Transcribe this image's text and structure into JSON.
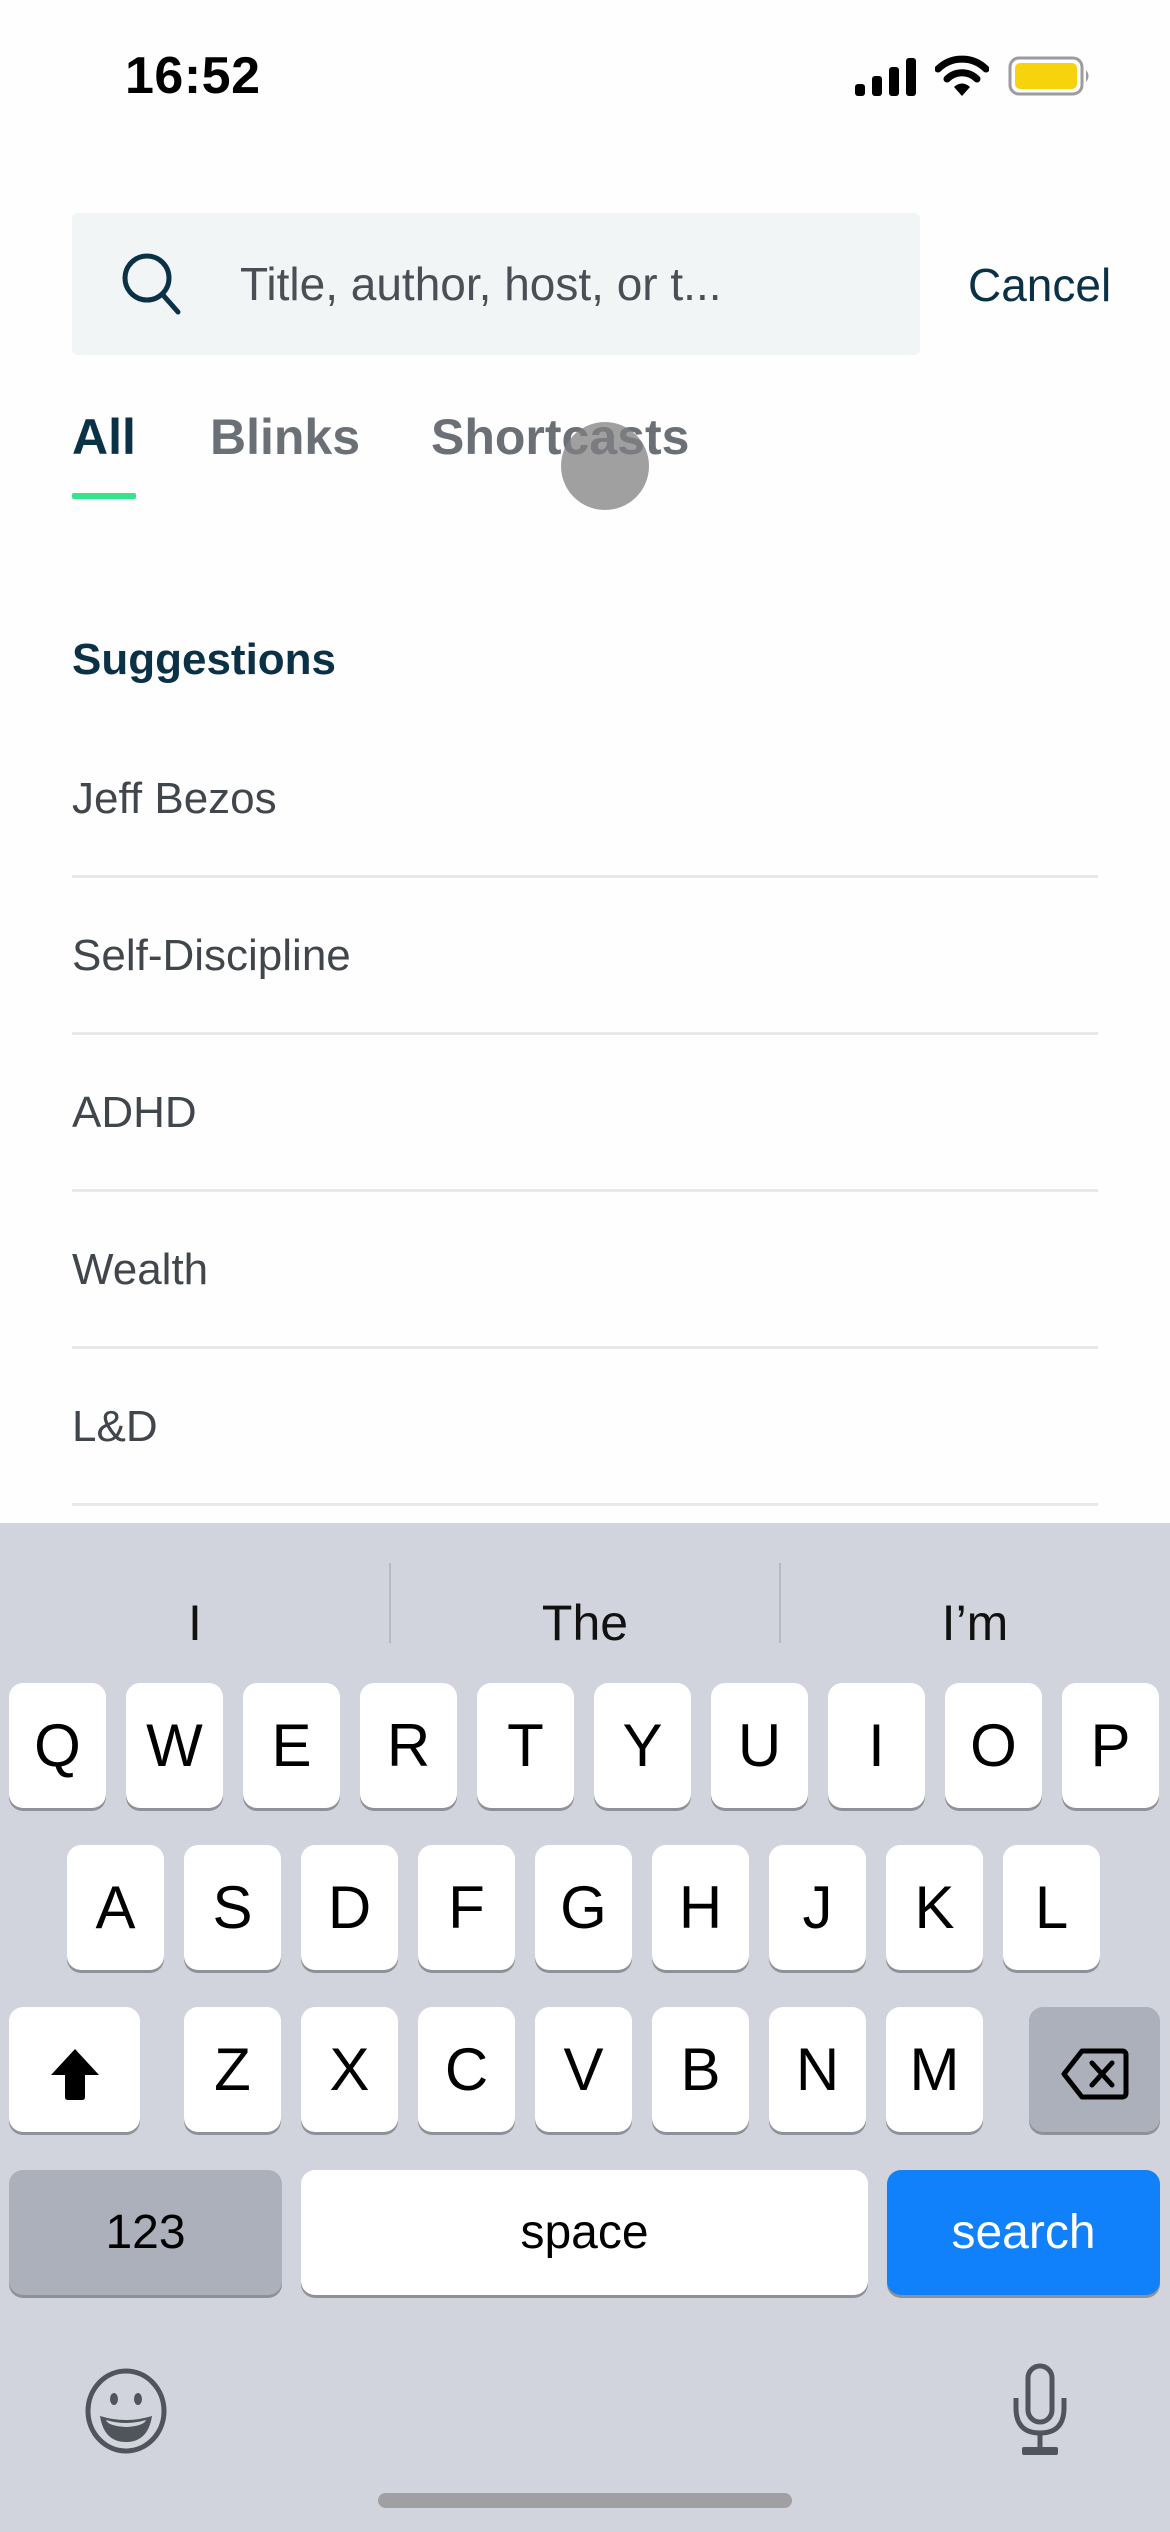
{
  "status_bar": {
    "time": "16:52",
    "icons": [
      "cellular-signal-icon",
      "wifi-icon",
      "battery-icon"
    ],
    "battery_color": "#f7d30e"
  },
  "search": {
    "placeholder": "Title, author, host, or t...",
    "value": "",
    "cancel_label": "Cancel",
    "icon": "search-icon"
  },
  "tabs": [
    {
      "label": "All",
      "active": true
    },
    {
      "label": "Blinks",
      "active": false
    },
    {
      "label": "Shortcasts",
      "active": false
    }
  ],
  "accent_color": "#34e58b",
  "suggestions": {
    "title": "Suggestions",
    "items": [
      "Jeff Bezos",
      "Self-Discipline",
      "ADHD",
      "Wealth",
      "L&D"
    ]
  },
  "keyboard": {
    "predictions": [
      "I",
      "The",
      "I’m"
    ],
    "row1": [
      "Q",
      "W",
      "E",
      "R",
      "T",
      "Y",
      "U",
      "I",
      "O",
      "P"
    ],
    "row2": [
      "A",
      "S",
      "D",
      "F",
      "G",
      "H",
      "J",
      "K",
      "L"
    ],
    "row3": [
      "Z",
      "X",
      "C",
      "V",
      "B",
      "N",
      "M"
    ],
    "numbers_label": "123",
    "space_label": "space",
    "action_label": "search",
    "action_color": "#1081fb",
    "icons": {
      "shift": "shift-icon",
      "delete": "delete-icon",
      "emoji": "emoji-icon",
      "mic": "microphone-icon"
    }
  }
}
